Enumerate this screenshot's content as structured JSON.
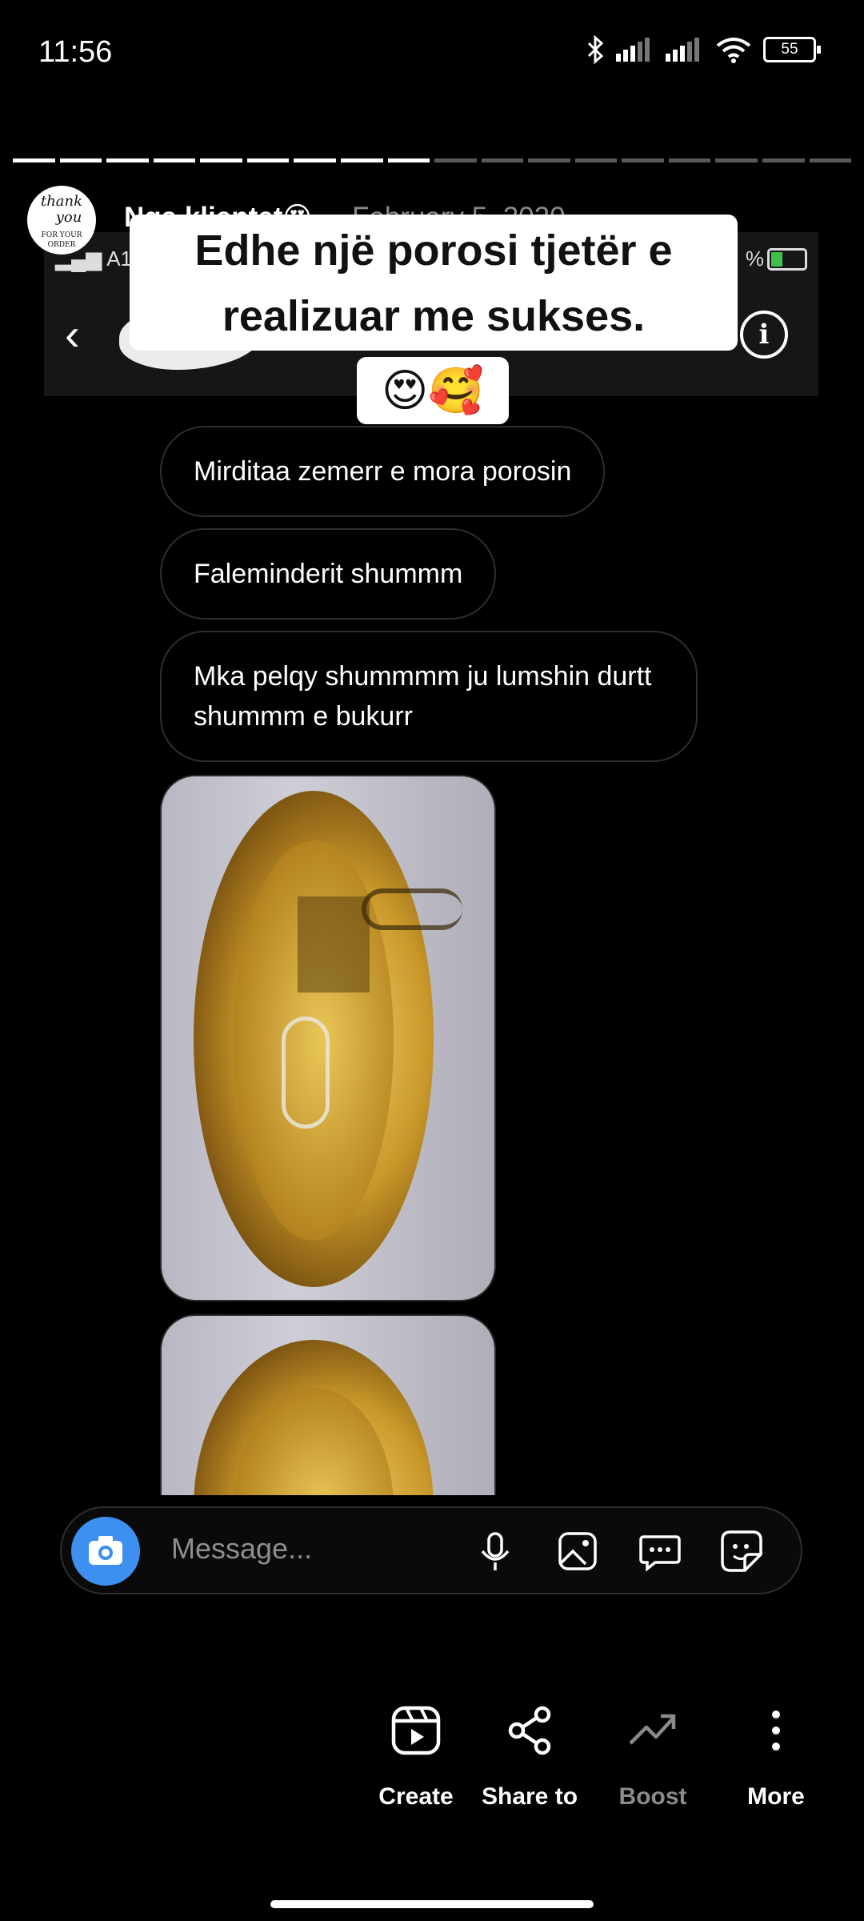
{
  "status": {
    "time": "11:56",
    "battery": "55"
  },
  "story": {
    "progress_segments": 18,
    "progress_done": 9,
    "avatar_text": [
      "thank",
      "you",
      "FOR YOUR ORDER"
    ],
    "username": "Nga klientet😍",
    "date": "February 5, 2020",
    "caption_line1": "Edhe një porosi tjetër e",
    "caption_line2": "realizuar me sukses.",
    "caption_emojis": "😍🥰"
  },
  "embedded_screen": {
    "carrier": "A1",
    "battery_pct": "%",
    "messages": [
      "Mirditaa zemerr e mora porosin",
      "Faleminderit shummm",
      "Mka pelqy shummmm ju lumshin durtt shummm e bukurr"
    ],
    "composer_placeholder": "Message...",
    "camera_color": "#3d8ff0"
  },
  "actions": [
    {
      "label": "Create",
      "icon": "reels-create-icon",
      "enabled": true
    },
    {
      "label": "Share to",
      "icon": "share-icon",
      "enabled": true
    },
    {
      "label": "Boost",
      "icon": "boost-icon",
      "enabled": false
    },
    {
      "label": "More",
      "icon": "more-dots-icon",
      "enabled": true
    }
  ]
}
